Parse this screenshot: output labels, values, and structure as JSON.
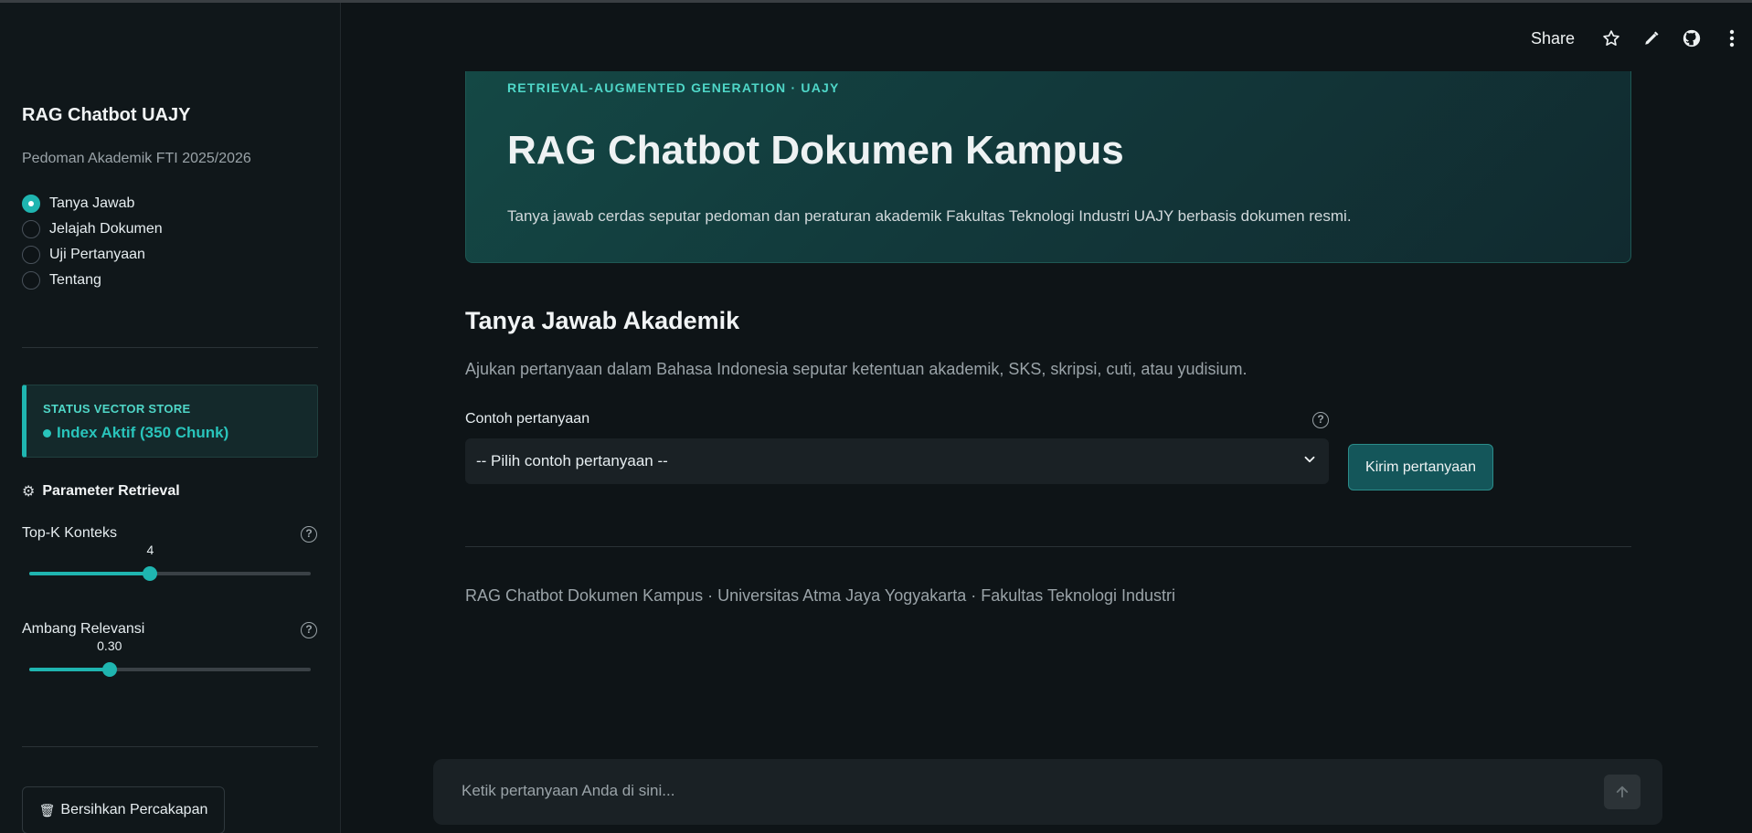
{
  "sidebar": {
    "app_title": "RAG Chatbot UAJY",
    "subtitle": "Pedoman Akademik FTI 2025/2026",
    "nav": [
      {
        "label": "Tanya Jawab",
        "selected": true
      },
      {
        "label": "Jelajah Dokumen",
        "selected": false
      },
      {
        "label": "Uji Pertanyaan",
        "selected": false
      },
      {
        "label": "Tentang",
        "selected": false
      }
    ],
    "status": {
      "label": "STATUS VECTOR STORE",
      "value": "Index Aktif (350 Chunk)"
    },
    "params_title": "Parameter Retrieval",
    "sliders": [
      {
        "label": "Top-K Konteks",
        "value": "4",
        "fraction": 0.43
      },
      {
        "label": "Ambang Relevansi",
        "value": "0.30",
        "fraction": 0.285
      }
    ],
    "clear_button": "Bersihkan Percakapan"
  },
  "header": {
    "share_label": "Share"
  },
  "hero": {
    "eyebrow": "RETRIEVAL-AUGMENTED GENERATION · UAJY",
    "title": "RAG Chatbot Dokumen Kampus",
    "description": "Tanya jawab cerdas seputar pedoman dan peraturan akademik Fakultas Teknologi Industri UAJY berbasis dokumen resmi."
  },
  "main": {
    "section_title": "Tanya Jawab Akademik",
    "section_desc": "Ajukan pertanyaan dalam Bahasa Indonesia seputar ketentuan akademik, SKS, skripsi, cuti, atau yudisium.",
    "select_label": "Contoh pertanyaan",
    "select_value": "-- Pilih contoh pertanyaan --",
    "send_button": "Kirim pertanyaan",
    "footer": "RAG Chatbot Dokumen Kampus · Universitas Atma Jaya Yogyakarta · Fakultas Teknologi Industri"
  },
  "chat": {
    "placeholder": "Ketik pertanyaan Anda di sini..."
  },
  "colors": {
    "accent": "#1fb5b0",
    "background": "#0e1417",
    "sidebar": "#10171a"
  }
}
